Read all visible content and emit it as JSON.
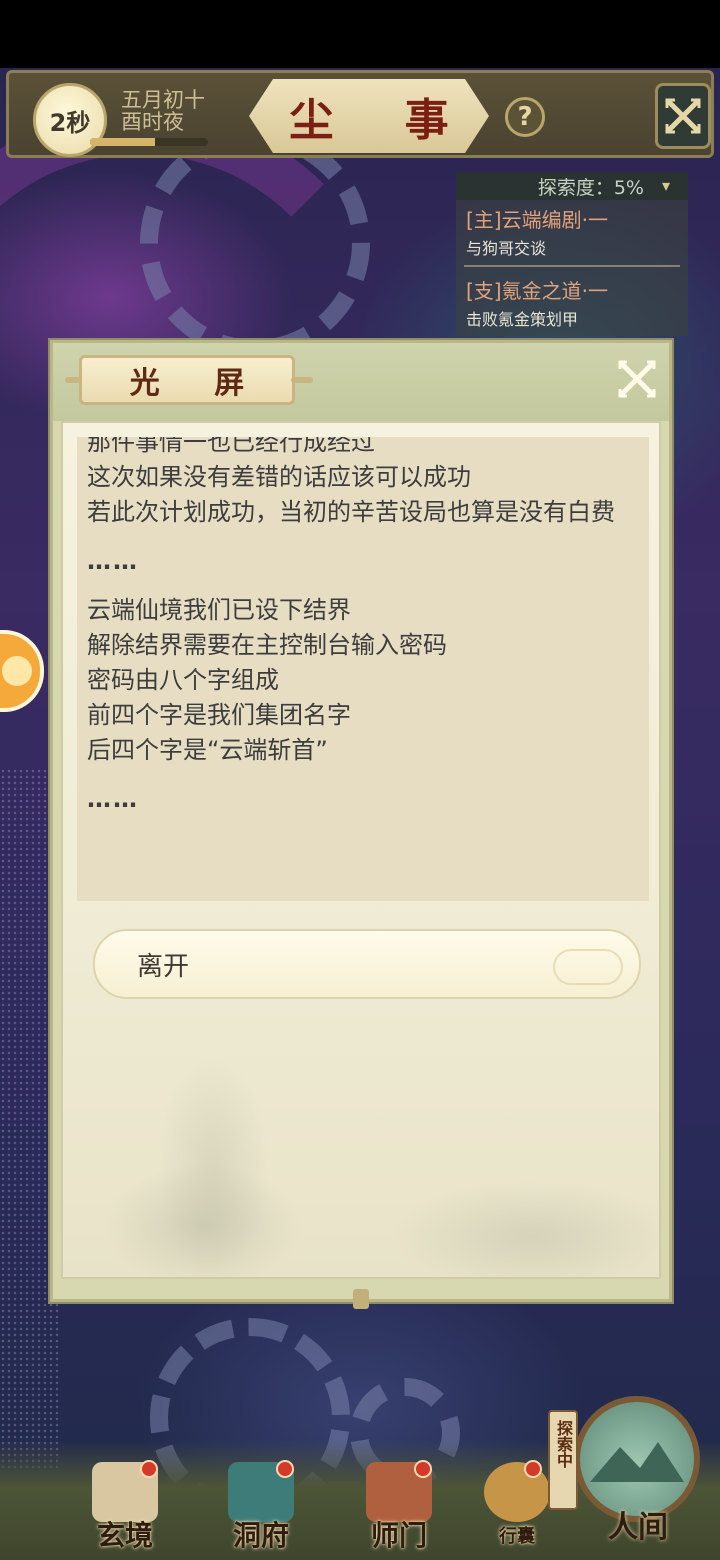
{
  "header": {
    "timer": "2秒",
    "date_line1": "五月初十",
    "date_line2": "酉时夜",
    "title": "尘 事",
    "help": "?",
    "time_progress": 0.55
  },
  "quest_tracker": {
    "exploration": "探索度：5%",
    "quests": [
      {
        "title": "[主]云端编剧·一",
        "desc": "与狗哥交谈"
      },
      {
        "title": "[支]氪金之道·一",
        "desc": "击败氪金策划甲"
      }
    ]
  },
  "dialog": {
    "title": "光 屏",
    "lines": [
      {
        "type": "text",
        "text": "那件事情一也已经行成经过"
      },
      {
        "type": "text",
        "text": "这次如果没有差错的话应该可以成功"
      },
      {
        "type": "text",
        "text": "若此次计划成功，当初的辛苦设局也算是没有白费"
      },
      {
        "type": "gap",
        "text": ""
      },
      {
        "type": "ellipsis",
        "text": "……"
      },
      {
        "type": "gap",
        "text": ""
      },
      {
        "type": "text",
        "text": "云端仙境我们已设下结界"
      },
      {
        "type": "text",
        "text": "解除结界需要在主控制台输入密码"
      },
      {
        "type": "text",
        "text": "密码由八个字组成"
      },
      {
        "type": "text",
        "text": "前四个字是我们集团名字"
      },
      {
        "type": "text",
        "text": "后四个字是“云端斩首”"
      },
      {
        "type": "gap",
        "text": ""
      },
      {
        "type": "ellipsis",
        "text": "……"
      }
    ],
    "leave_button": "离开"
  },
  "bottom_nav": {
    "items": [
      {
        "label": "玄境"
      },
      {
        "label": "洞府"
      },
      {
        "label": "师门"
      },
      {
        "label": "行囊"
      }
    ],
    "realm_label": "人间",
    "exploring_tag": "探索中"
  },
  "colors": {
    "dialog_frame": "#d8d8b0",
    "paper": "#f5f2df",
    "text_box": "#e6ddc3",
    "title_red": "#7a1f12",
    "notification_dot": "#d33a2a"
  }
}
